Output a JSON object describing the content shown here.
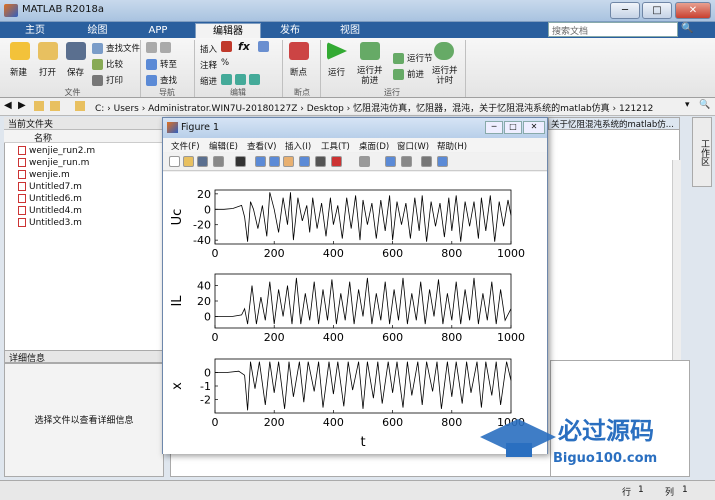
{
  "window": {
    "title": "MATLAB R2018a",
    "min": "─",
    "max": "□",
    "close": "✕"
  },
  "tabs": [
    "主页",
    "绘图",
    "APP",
    "编辑器",
    "发布",
    "视图"
  ],
  "search": {
    "placeholder": "搜索文档"
  },
  "ribbon": {
    "new": "新建",
    "open": "打开",
    "save": "保存",
    "find_files": "查找文件",
    "compare": "比较",
    "print": "打印",
    "insert": "插入",
    "fx": "fx",
    "comment": "注释",
    "indent": "缩进",
    "goto": "转至",
    "find": "查找",
    "breakpoints": "断点",
    "run": "运行",
    "run_advance": "运行并\n前进",
    "run_section": "运行节",
    "advance": "前进",
    "run_time": "运行并\n计时",
    "groups": {
      "file": "文件",
      "nav": "导航",
      "edit": "编辑",
      "bp": "断点",
      "run": "运行"
    }
  },
  "address": {
    "path": "C: › Users › Administrator.WIN7U-20180127Z › Desktop › 忆阻混沌仿真，忆阻器，混沌，关于忆阻混沌系统的matlab仿真 › 121212"
  },
  "current_folder": {
    "title": "当前文件夹",
    "col_name": "名称",
    "files": [
      "wenjie_run2.m",
      "wenjie_run.m",
      "wenjie.m",
      "Untitled7.m",
      "Untitled6.m",
      "Untitled4.m",
      "Untitled3.m"
    ]
  },
  "details": {
    "title": "详细信息",
    "empty_text": "选择文件以查看详细信息"
  },
  "editor_tab": {
    "title": "关于忆阻混沌系统的matlab仿..."
  },
  "right_strip": {
    "label": "工作区"
  },
  "status": {
    "row_label": "行",
    "row": "1",
    "col_label": "列",
    "col": "1"
  },
  "figure": {
    "title": "Figure 1",
    "menu": [
      "文件(F)",
      "编辑(E)",
      "查看(V)",
      "插入(I)",
      "工具(T)",
      "桌面(D)",
      "窗口(W)",
      "帮助(H)"
    ],
    "xlabel": "t"
  },
  "chart_data": [
    {
      "type": "line",
      "ylabel": "Uc",
      "xlim": [
        0,
        1000
      ],
      "ylim": [
        -45,
        25
      ],
      "xticks": [
        "0",
        "200",
        "400",
        "600",
        "800",
        "1000"
      ],
      "yticks": [
        "20",
        "0",
        "-20",
        "-40"
      ],
      "series": [
        {
          "x": [
            0,
            30,
            60,
            90,
            100,
            110,
            120,
            130,
            145,
            160,
            175,
            185,
            200,
            215,
            230,
            245,
            255,
            265,
            280,
            295,
            310,
            320,
            330,
            345,
            360,
            375,
            390,
            400,
            415,
            430,
            445,
            460,
            475,
            490,
            500,
            515,
            530,
            545,
            560,
            575,
            590,
            600,
            615,
            630,
            645,
            660,
            675,
            690,
            700,
            715,
            730,
            745,
            760,
            775,
            790,
            800,
            815,
            830,
            845,
            860,
            875,
            890,
            900,
            915,
            930,
            945,
            960,
            975,
            990,
            1000
          ],
          "y": [
            0,
            0,
            1,
            5,
            -10,
            -42,
            10,
            0,
            -25,
            5,
            -35,
            22,
            0,
            -30,
            15,
            -20,
            22,
            -40,
            15,
            -15,
            5,
            -30,
            15,
            -25,
            8,
            -35,
            15,
            -20,
            5,
            -38,
            15,
            -25,
            18,
            -40,
            12,
            -20,
            8,
            -38,
            12,
            -28,
            18,
            -40,
            10,
            -20,
            8,
            -38,
            15,
            -28,
            18,
            -42,
            10,
            -22,
            8,
            -36,
            15,
            -28,
            18,
            -42,
            10,
            -22,
            10,
            -38,
            15,
            -28,
            18,
            -42,
            10,
            -22,
            12,
            -8
          ]
        }
      ]
    },
    {
      "type": "line",
      "ylabel": "IL",
      "xlim": [
        0,
        1000
      ],
      "ylim": [
        -15,
        55
      ],
      "xticks": [
        "0",
        "200",
        "400",
        "600",
        "800",
        "1000"
      ],
      "yticks": [
        "40",
        "20",
        "0"
      ],
      "series": [
        {
          "x": [
            0,
            30,
            60,
            90,
            100,
            110,
            125,
            140,
            155,
            170,
            185,
            200,
            215,
            230,
            245,
            260,
            275,
            290,
            305,
            320,
            335,
            350,
            365,
            380,
            395,
            410,
            425,
            440,
            455,
            470,
            485,
            500,
            515,
            530,
            545,
            560,
            575,
            590,
            605,
            620,
            635,
            650,
            665,
            680,
            695,
            710,
            725,
            740,
            755,
            770,
            785,
            800,
            815,
            830,
            845,
            860,
            875,
            890,
            905,
            920,
            935,
            950,
            965,
            980,
            1000
          ],
          "y": [
            0,
            0,
            0,
            2,
            10,
            -10,
            40,
            -10,
            25,
            -5,
            45,
            -10,
            35,
            0,
            40,
            -10,
            50,
            -10,
            30,
            -5,
            45,
            -10,
            35,
            -5,
            48,
            -10,
            30,
            -5,
            45,
            -10,
            35,
            0,
            50,
            -10,
            30,
            -5,
            45,
            -10,
            35,
            -5,
            50,
            -10,
            30,
            -5,
            45,
            -10,
            35,
            0,
            48,
            -10,
            30,
            -5,
            45,
            -10,
            35,
            -5,
            50,
            -10,
            30,
            -5,
            45,
            -10,
            35,
            -5,
            10
          ]
        }
      ]
    },
    {
      "type": "line",
      "ylabel": "x",
      "xlim": [
        0,
        1000
      ],
      "ylim": [
        -3,
        1
      ],
      "xticks": [
        "0",
        "200",
        "400",
        "600",
        "800",
        "1000"
      ],
      "yticks": [
        "0",
        "-1",
        "-2"
      ],
      "series": [
        {
          "x": [
            0,
            40,
            80,
            100,
            110,
            120,
            135,
            150,
            170,
            185,
            200,
            215,
            235,
            250,
            265,
            285,
            300,
            315,
            335,
            350,
            365,
            385,
            400,
            415,
            435,
            450,
            465,
            485,
            500,
            515,
            535,
            550,
            565,
            585,
            600,
            615,
            635,
            650,
            665,
            685,
            700,
            715,
            735,
            750,
            765,
            785,
            800,
            815,
            835,
            850,
            865,
            885,
            900,
            915,
            935,
            950,
            965,
            985,
            1000
          ],
          "y": [
            0,
            0,
            0.1,
            -0.2,
            -2.8,
            0.8,
            -1.2,
            0.8,
            -2.4,
            0.8,
            -1.5,
            0.8,
            -2.7,
            0.8,
            -1.8,
            0.8,
            -2.2,
            0.8,
            -1.4,
            0.8,
            -2.6,
            0.8,
            -1.6,
            0.8,
            -2.5,
            0.8,
            -1.3,
            0.8,
            -2.7,
            0.8,
            -1.9,
            0.8,
            -2.3,
            0.8,
            -1.5,
            0.8,
            -2.6,
            0.8,
            -1.7,
            0.8,
            -2.4,
            0.8,
            -1.4,
            0.8,
            -2.7,
            0.8,
            -1.8,
            0.8,
            -2.3,
            0.8,
            -1.5,
            0.8,
            -2.6,
            0.8,
            -1.7,
            0.8,
            -2.4,
            0.8,
            -0.6
          ]
        }
      ]
    }
  ]
}
